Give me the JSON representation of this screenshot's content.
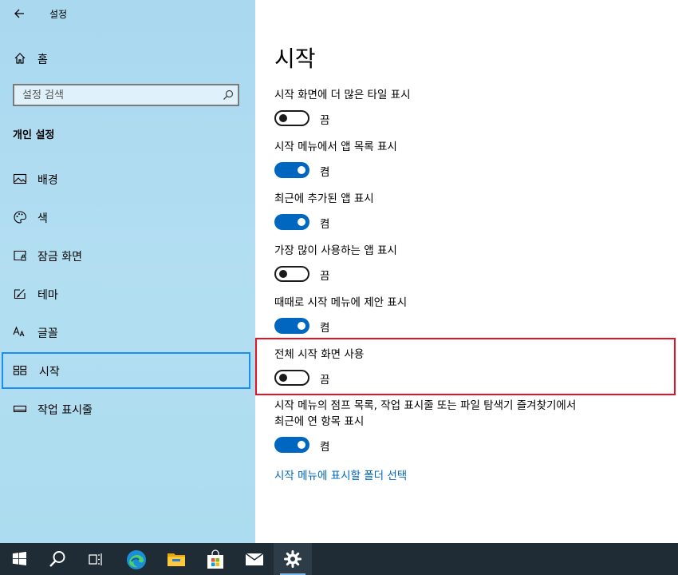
{
  "window": {
    "title": "설정"
  },
  "sidebar": {
    "home_label": "홈",
    "search_placeholder": "설정 검색",
    "section_title": "개인 설정",
    "items": [
      {
        "label": "배경",
        "icon": "picture-icon"
      },
      {
        "label": "색",
        "icon": "palette-icon"
      },
      {
        "label": "잠금 화면",
        "icon": "lock-screen-icon"
      },
      {
        "label": "테마",
        "icon": "theme-icon"
      },
      {
        "label": "글꼴",
        "icon": "font-icon"
      },
      {
        "label": "시작",
        "icon": "start-icon",
        "selected": true
      },
      {
        "label": "작업 표시줄",
        "icon": "taskbar-icon"
      }
    ]
  },
  "main": {
    "title": "시작",
    "settings": [
      {
        "label": "시작 화면에 더 많은 타일 표시",
        "on": false,
        "state": "끔"
      },
      {
        "label": "시작 메뉴에서 앱 목록 표시",
        "on": true,
        "state": "켬"
      },
      {
        "label": "최근에 추가된 앱 표시",
        "on": true,
        "state": "켬"
      },
      {
        "label": "가장 많이 사용하는 앱 표시",
        "on": false,
        "state": "끔"
      },
      {
        "label": "때때로 시작 메뉴에 제안 표시",
        "on": true,
        "state": "켬"
      },
      {
        "label": "전체 시작 화면 사용",
        "on": false,
        "state": "끔"
      },
      {
        "label": "시작 메뉴의 점프 목록, 작업 표시줄 또는 파일 탐색기 즐겨찾기에서",
        "label2": "최근에 연 항목 표시",
        "on": true,
        "state": "켬"
      }
    ],
    "link": "시작 메뉴에 표시할 폴더 선택"
  },
  "colors": {
    "accent": "#0067c0",
    "highlight": "#e81123",
    "selection_border": "#1b8ef0"
  },
  "taskbar": {
    "items": [
      "windows-start-icon",
      "search-icon",
      "task-view-icon",
      "edge-icon",
      "file-explorer-icon",
      "store-icon",
      "mail-icon",
      "settings-icon"
    ]
  }
}
